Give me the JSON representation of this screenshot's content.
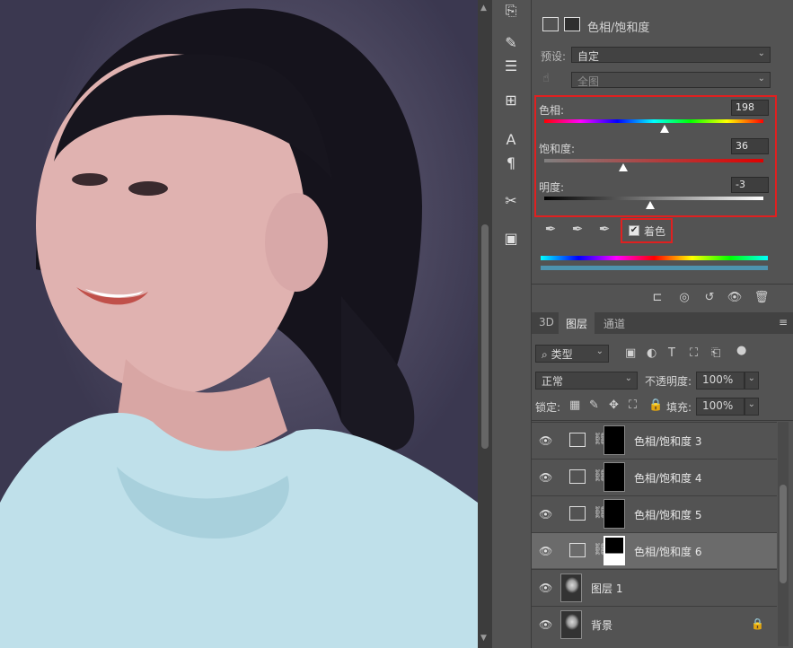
{
  "properties": {
    "title": "色相/饱和度",
    "preset_label": "预设:",
    "preset_value": "自定",
    "channel_value": "全图",
    "hue_label": "色相:",
    "hue_value": "198",
    "saturation_label": "饱和度:",
    "saturation_value": "36",
    "lightness_label": "明度:",
    "lightness_value": "-3",
    "colorize_label": "着色",
    "colorize_checked": true,
    "highlight_color": "#e02020"
  },
  "layers_panel": {
    "tabs": [
      "3D",
      "图层",
      "通道"
    ],
    "active_tab": "图层",
    "filter_label": "类型",
    "blend_mode": "正常",
    "opacity_label": "不透明度:",
    "opacity_value": "100%",
    "lock_label": "锁定:",
    "fill_label": "填充:",
    "fill_value": "100%",
    "layers": [
      {
        "name": "色相/饱和度 3",
        "type": "adjustment",
        "visible": true
      },
      {
        "name": "色相/饱和度 4",
        "type": "adjustment",
        "visible": true
      },
      {
        "name": "色相/饱和度 5",
        "type": "adjustment",
        "visible": true
      },
      {
        "name": "色相/饱和度 6",
        "type": "adjustment",
        "visible": true,
        "selected": true
      },
      {
        "name": "图层 1",
        "type": "pixel",
        "visible": true
      },
      {
        "name": "背景",
        "type": "background",
        "visible": true,
        "locked": true
      }
    ]
  }
}
